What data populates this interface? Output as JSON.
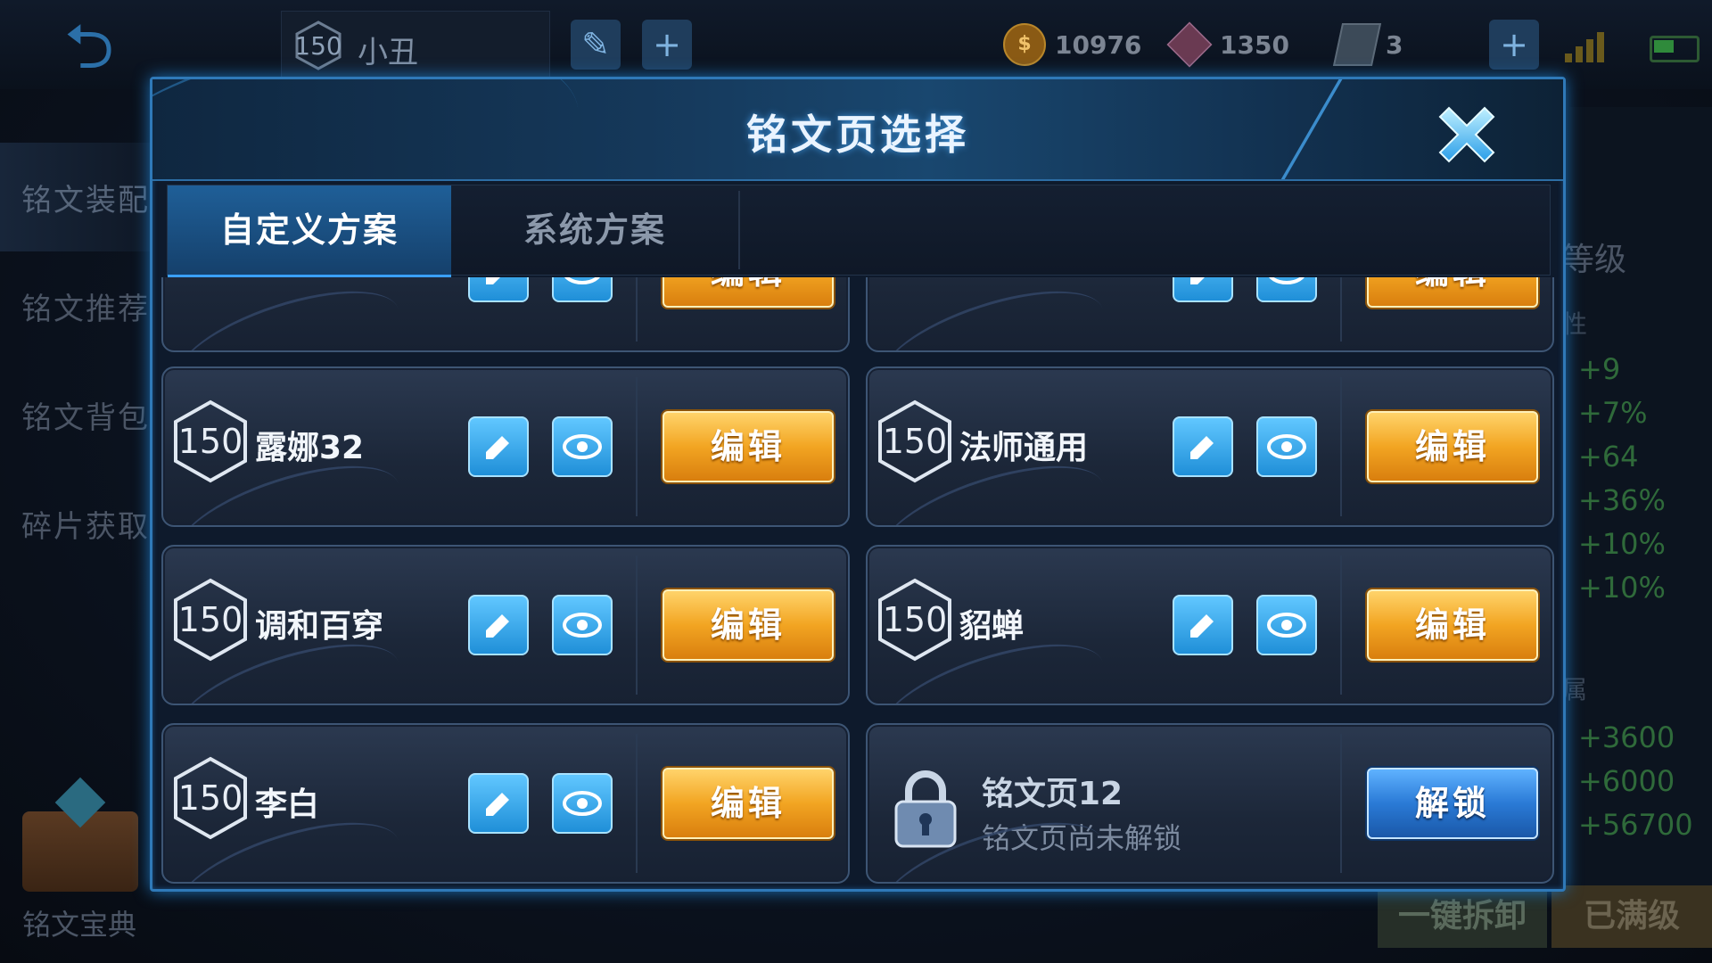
{
  "topbar": {
    "player_level": "150",
    "player_name": "小丑",
    "gold": "10976",
    "gems": "1350",
    "tickets": "3"
  },
  "side_menu": {
    "items": [
      "铭文装配",
      "铭文推荐",
      "铭文背包",
      "碎片获取"
    ],
    "codex": "铭文宝典"
  },
  "right_panel": {
    "level_label": "等级",
    "attr_label": "性",
    "stats": [
      "+9",
      "+7%",
      "+64",
      "+36%",
      "+10%",
      "+10%"
    ],
    "attr_label2": "属",
    "stats2": [
      "+3600",
      "+6000",
      "+56700"
    ],
    "disassemble": "一键拆卸",
    "maxed": "已满级"
  },
  "modal": {
    "title": "铭文页选择",
    "tabs": [
      {
        "label": "自定义方案",
        "active": true
      },
      {
        "label": "系统方案",
        "active": false
      }
    ],
    "edit_label": "编辑",
    "unlock_label": "解锁",
    "pages": [
      {
        "level": "150",
        "name": "露娜32"
      },
      {
        "level": "150",
        "name": "法师通用"
      },
      {
        "level": "150",
        "name": "调和百穿"
      },
      {
        "level": "150",
        "name": "貂蝉"
      },
      {
        "level": "150",
        "name": "李白"
      }
    ],
    "locked_page": {
      "name": "铭文页12",
      "status": "铭文页尚未解锁"
    },
    "partial_top_edit": "编辑"
  },
  "colors": {
    "accent": "#2f79b8",
    "edit_gold": "#f2a522",
    "unlock_blue": "#2a7ad6"
  },
  "icons": [
    "back-icon",
    "edit-name-icon",
    "preview-eye-icon",
    "lock-icon",
    "close-icon"
  ]
}
